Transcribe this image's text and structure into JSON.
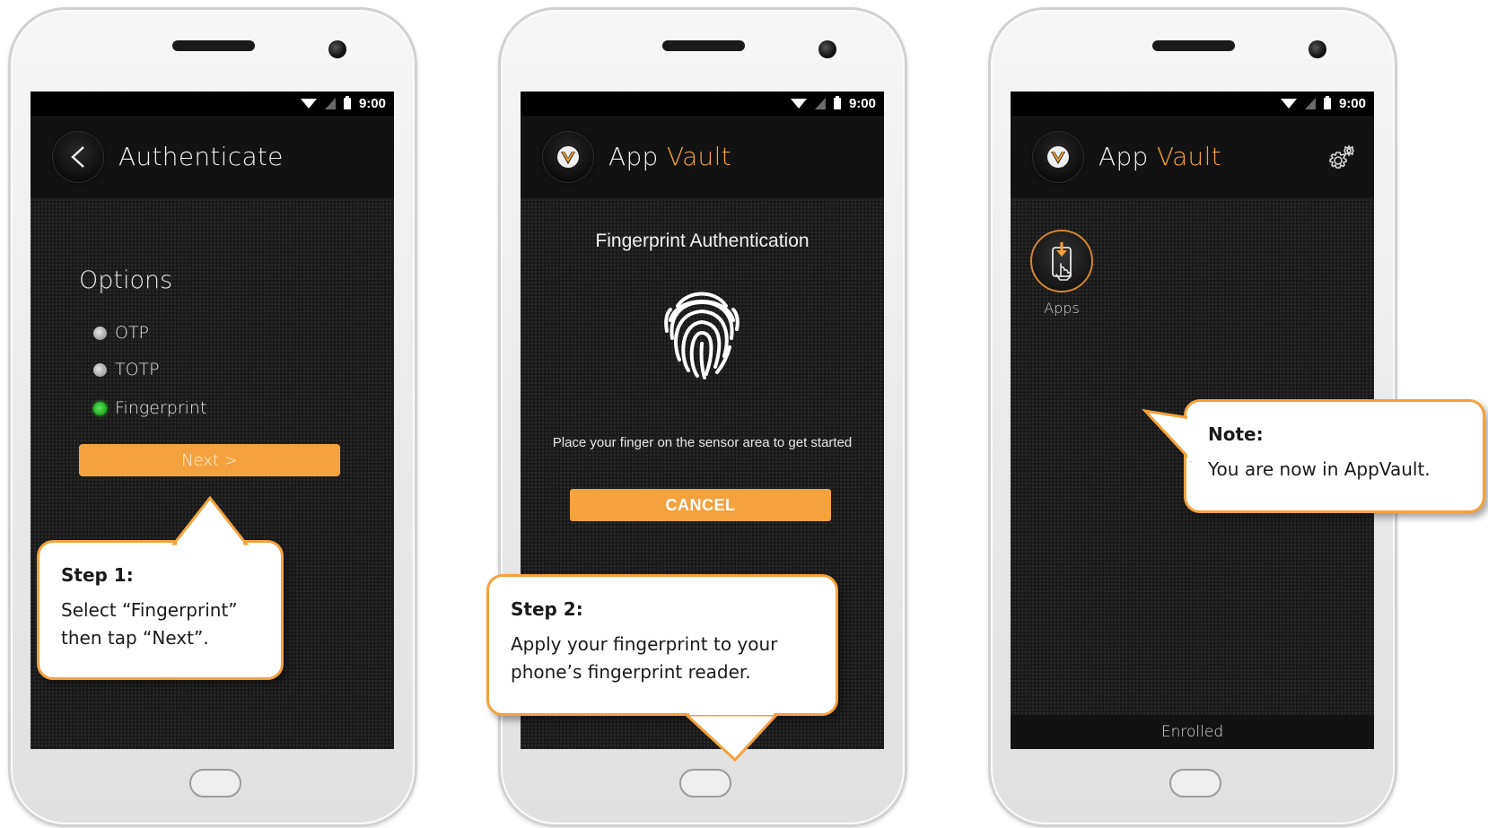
{
  "status_bar": {
    "time": "9:00"
  },
  "screen1": {
    "title": "Authenticate",
    "options_heading": "Options",
    "options": [
      {
        "label": "OTP",
        "selected": false
      },
      {
        "label": "TOTP",
        "selected": false
      },
      {
        "label": "Fingerprint",
        "selected": true
      }
    ],
    "next_label": "Next >",
    "callout": {
      "heading": "Step 1:",
      "line1": "Select “Fingerprint”",
      "line2": "then tap “Next”."
    }
  },
  "screen2": {
    "app_word": "App",
    "vault_word": "Vault",
    "fp_title": "Fingerprint Authentication",
    "instruction": "Place your finger on the sensor area to get started",
    "cancel_label": "CANCEL",
    "callout": {
      "heading": "Step 2:",
      "line1": "Apply your fingerprint to your",
      "line2": "phone’s fingerprint reader."
    }
  },
  "screen3": {
    "app_word": "App",
    "vault_word": "Vault",
    "apps_label": "Apps",
    "footer": "Enrolled",
    "callout": {
      "heading": "Note:",
      "line1": "You are now in AppVault."
    }
  },
  "colors": {
    "accent": "#f3a23d",
    "screen_bg": "#191919",
    "selected_radio": "#2fd12c"
  },
  "icons": [
    "back-arrow-icon",
    "appvault-logo-icon",
    "fingerprint-icon",
    "gear-icon",
    "apps-download-icon",
    "wifi-icon",
    "signal-icon",
    "battery-icon"
  ]
}
